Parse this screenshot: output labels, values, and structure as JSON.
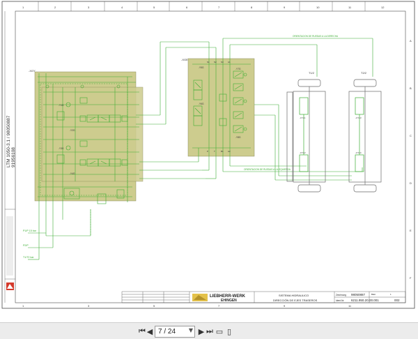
{
  "sheet": {
    "col_numbers": [
      "1",
      "2",
      "3",
      "4",
      "5",
      "6",
      "7",
      "8",
      "9",
      "10",
      "11",
      "12"
    ],
    "row_letters": [
      "A",
      "B",
      "C",
      "D",
      "E",
      "F"
    ],
    "side_title_line1": "LTM 1050-3.1 / 98050887",
    "side_title_line2": "91956108",
    "brand": "LIEBHERR-WERK",
    "brand_city": "EHINGEN",
    "title_line1": "SISTEMA HIDRAULICO",
    "title_line2": "DIRECCIÓN DE EJES TRASEROS",
    "drawing_no_label": "Zeichnung",
    "drawing_no": "98050887",
    "ident_label": "Ident-Nr.",
    "ident_no": "6211.950.20.00.001",
    "sheet_no": "002",
    "blatt_label": "Blatt",
    "blatt_value": "1"
  },
  "diagram": {
    "block1_tag": "-XGY",
    "block2_tag": "-XGE",
    "axle1_label": "T1/2",
    "axle2_label": "T2/2",
    "right_steer_note": "ORIENTACION DE RUEDAS A LA DERECHA",
    "left_steer_note": "ORIENTACION DE RUEDAS A LA IZQUIERDA",
    "port_labels": [
      "S1",
      "S2",
      "S3",
      "A1",
      "B1",
      "A2",
      "B2",
      "P",
      "T",
      "L"
    ],
    "valve_tags": [
      "-Y1G",
      "-Y2G",
      "-Y3G",
      "-Y4G",
      "-Y5G",
      "-Y6G",
      "-Y7G",
      "-Y8G"
    ],
    "cyl_tags": [
      "-CYL1",
      "-CYL2",
      "-CYL3",
      "-CYL4"
    ],
    "inlet_labels": [
      "P1/P 15 bar",
      "P2/P",
      "T1/T2 bar"
    ]
  },
  "viewer": {
    "page_current": "7",
    "page_total": "24",
    "page_display": "7 / 24"
  },
  "colors": {
    "line": "#3cae33",
    "fill": "#cdcc8e",
    "block_edge": "#8b8b5a",
    "frame": "#4a4a4a"
  }
}
